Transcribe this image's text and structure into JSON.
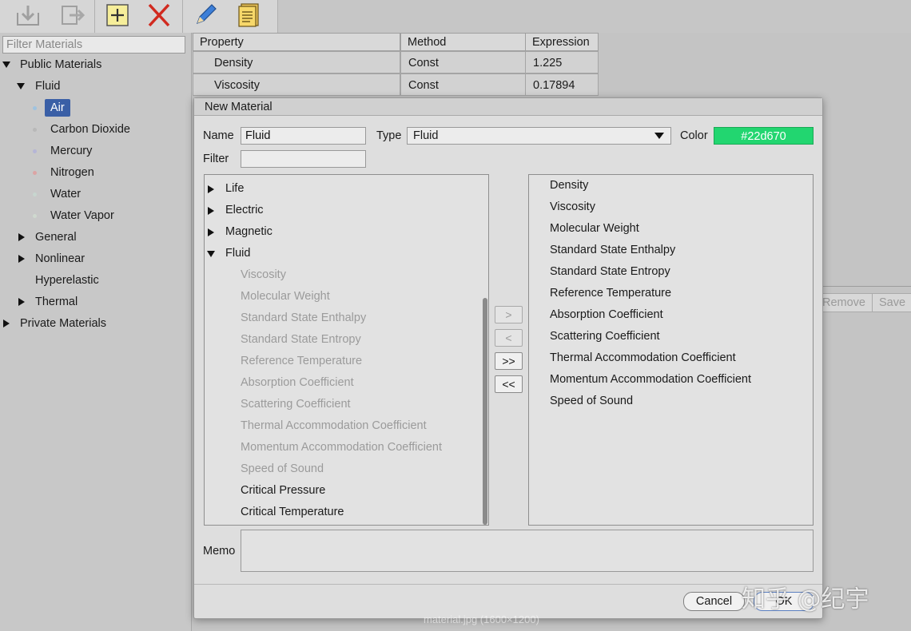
{
  "toolbar": {
    "buttons": [
      {
        "icon": "import-icon"
      },
      {
        "icon": "export-icon"
      },
      {
        "icon": "add-icon"
      },
      {
        "icon": "delete-icon"
      },
      {
        "icon": "edit-icon"
      },
      {
        "icon": "document-icon"
      }
    ]
  },
  "sidebar": {
    "filter_placeholder": "Filter Materials",
    "tree": {
      "public": "Public Materials",
      "fluid": "Fluid",
      "fluid_items": [
        "Air",
        "Carbon Dioxide",
        "Mercury",
        "Nitrogen",
        "Water",
        "Water Vapor"
      ],
      "general": "General",
      "nonlinear": "Nonlinear",
      "hyperelastic": "Hyperelastic",
      "thermal": "Thermal",
      "private": "Private Materials"
    }
  },
  "properties_table": {
    "headers": [
      "Property",
      "Method",
      "Expression"
    ],
    "rows": [
      [
        "Density",
        "Const",
        "1.225"
      ],
      [
        "Viscosity",
        "Const",
        "0.17894"
      ]
    ]
  },
  "main_buttons": {
    "remove": "Remove",
    "save": "Save"
  },
  "dialog": {
    "title": "New Material",
    "name_label": "Name",
    "name_value": "Fluid",
    "type_label": "Type",
    "type_value": "Fluid",
    "color_label": "Color",
    "color_value": "#22d670",
    "filter_label": "Filter",
    "filter_value": "",
    "available": {
      "groups": [
        "Life",
        "Electric",
        "Magnetic",
        "Fluid"
      ],
      "fluid_children_disabled": [
        "Viscosity",
        "Molecular Weight",
        "Standard State Enthalpy",
        "Standard State Entropy",
        "Reference Temperature",
        "Absorption Coefficient",
        "Scattering Coefficient",
        "Thermal Accommodation Coefficient",
        "Momentum Accommodation Coefficient",
        "Speed of Sound"
      ],
      "fluid_children_enabled": [
        "Critical Pressure",
        "Critical Temperature"
      ]
    },
    "move_buttons": {
      "add_one": ">",
      "remove_one": "<",
      "add_all": ">>",
      "remove_all": "<<"
    },
    "selected": [
      "Density",
      "Viscosity",
      "Molecular Weight",
      "Standard State Enthalpy",
      "Standard State Entropy",
      "Reference Temperature",
      "Absorption Coefficient",
      "Scattering Coefficient",
      "Thermal Accommodation Coefficient",
      "Momentum Accommodation Coefficient",
      "Speed of Sound"
    ],
    "memo_label": "Memo",
    "memo_value": "",
    "cancel_label": "Cancel",
    "ok_label": "OK"
  },
  "overlay": {
    "watermark": "知乎 @纪宇",
    "caption": "material.jpg (1600×1200)"
  },
  "colors": {
    "selection": "#3a5fa6",
    "material_color": "#22d670"
  }
}
